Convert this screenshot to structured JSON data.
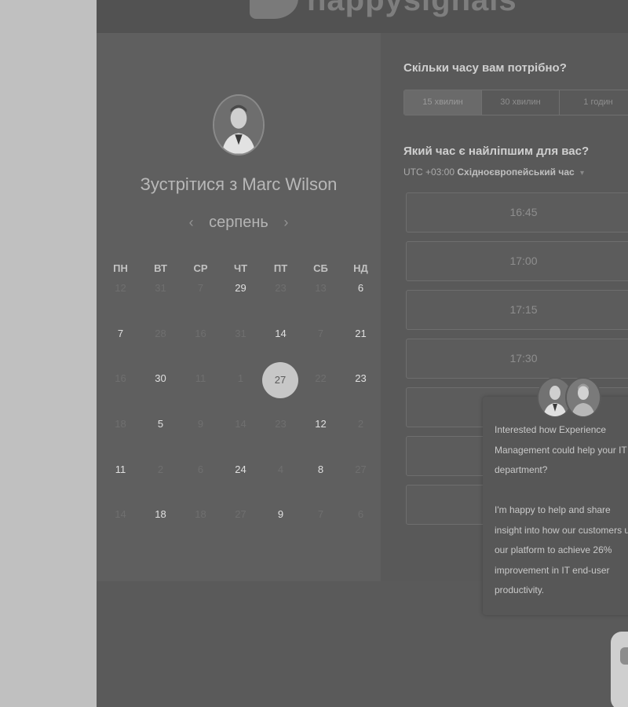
{
  "header": {
    "logo_text": "happysignals"
  },
  "calendar": {
    "title": "Зустрітися з Marc Wilson",
    "month": "серпень",
    "prev_icon": "‹",
    "next_icon": "›",
    "days_of_week": [
      "ПН",
      "ВТ",
      "СР",
      "ЧТ",
      "ПТ",
      "СБ",
      "НД"
    ],
    "weeks": [
      [
        {
          "d": "12",
          "a": false
        },
        {
          "d": "31",
          "a": false
        },
        {
          "d": "7",
          "a": false
        },
        {
          "d": "29",
          "a": true
        },
        {
          "d": "23",
          "a": false
        },
        {
          "d": "13",
          "a": false
        },
        {
          "d": "6",
          "a": true
        }
      ],
      [
        {
          "d": "7",
          "a": true
        },
        {
          "d": "28",
          "a": false
        },
        {
          "d": "16",
          "a": false
        },
        {
          "d": "31",
          "a": false
        },
        {
          "d": "14",
          "a": true
        },
        {
          "d": "7",
          "a": false
        },
        {
          "d": "21",
          "a": true
        }
      ],
      [
        {
          "d": "16",
          "a": false
        },
        {
          "d": "30",
          "a": true
        },
        {
          "d": "11",
          "a": false
        },
        {
          "d": "1",
          "a": false
        },
        {
          "d": "27",
          "a": true,
          "selected": true
        },
        {
          "d": "22",
          "a": false
        },
        {
          "d": "23",
          "a": true
        }
      ],
      [
        {
          "d": "18",
          "a": false
        },
        {
          "d": "5",
          "a": true
        },
        {
          "d": "9",
          "a": false
        },
        {
          "d": "14",
          "a": false
        },
        {
          "d": "23",
          "a": false
        },
        {
          "d": "12",
          "a": true
        },
        {
          "d": "2",
          "a": false
        }
      ],
      [
        {
          "d": "11",
          "a": true
        },
        {
          "d": "2",
          "a": false
        },
        {
          "d": "6",
          "a": false
        },
        {
          "d": "24",
          "a": true
        },
        {
          "d": "4",
          "a": false
        },
        {
          "d": "8",
          "a": true
        },
        {
          "d": "27",
          "a": false
        }
      ],
      [
        {
          "d": "14",
          "a": false
        },
        {
          "d": "18",
          "a": true
        },
        {
          "d": "18",
          "a": false
        },
        {
          "d": "27",
          "a": false
        },
        {
          "d": "9",
          "a": true
        },
        {
          "d": "7",
          "a": false
        },
        {
          "d": "6",
          "a": false
        }
      ]
    ]
  },
  "booking": {
    "duration_question": "Скільки часу вам потрібно?",
    "durations": [
      {
        "label": "15 хвилин",
        "active": true
      },
      {
        "label": "30 хвилин",
        "active": false
      },
      {
        "label": "1 годин",
        "active": false
      }
    ],
    "time_question": "Який час є найліпшим для вас?",
    "tz_offset": "UTC +03:00",
    "tz_name": "Східноєвропейський час",
    "tz_caret": "▾",
    "slots": [
      "16:45",
      "17:00",
      "17:15",
      "17:30",
      "",
      "",
      ""
    ]
  },
  "chat": {
    "message": "Interested how Experience Management could help your IT department?\n\nI'm happy to help and share insight into how our customers use our platform to achieve 26% improvement in IT end-user productivity."
  }
}
